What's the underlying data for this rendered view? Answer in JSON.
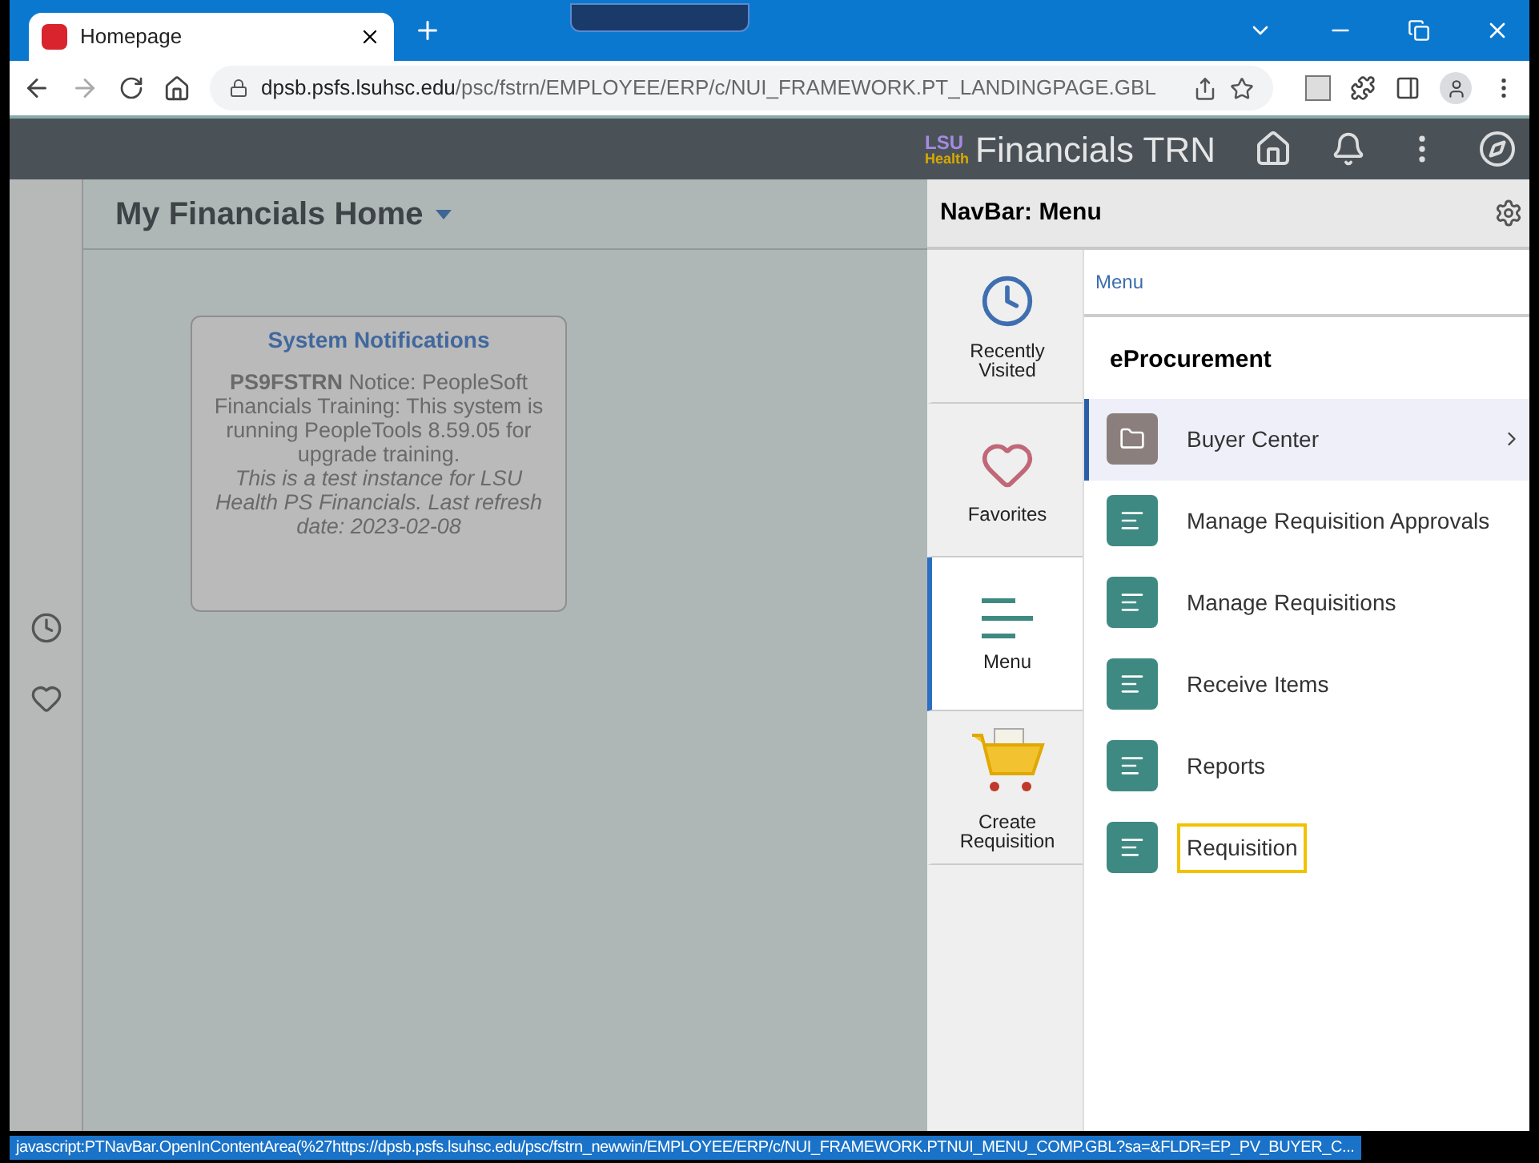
{
  "browser": {
    "tab_title": "Homepage",
    "url_host": "dpsb.psfs.lsuhsc.edu",
    "url_path": "/psc/fstrn/EMPLOYEE/ERP/c/NUI_FRAMEWORK.PT_LANDINGPAGE.GBL",
    "status_url": "javascript:PTNavBar.OpenInContentArea(%27https://dpsb.psfs.lsuhsc.edu/psc/fstrn_newwin/EMPLOYEE/ERP/c/NUI_FRAMEWORK.PTNUI_MENU_COMP.GBL?sa=&FLDR=EP_PV_BUYER_C..."
  },
  "header": {
    "logo_top": "LSU",
    "logo_bottom": "Health",
    "title": "Financials TRN"
  },
  "page": {
    "title": "My Financials Home"
  },
  "notification": {
    "title": "System Notifications",
    "body": "**PS9FSTRN** Notice: PeopleSoft Financials Training: This system is running PeopleTools 8.59.05 for upgrade training.",
    "note": "This is a test instance for LSU Health PS Financials. Last refresh date: 2023-02-08"
  },
  "navbar": {
    "title": "NavBar: Menu",
    "tabs": [
      {
        "kind": "clock",
        "label": "Recently Visited",
        "selected": false
      },
      {
        "kind": "heart",
        "label": "Favorites",
        "selected": false
      },
      {
        "kind": "menu",
        "label": "Menu",
        "selected": true
      },
      {
        "kind": "cart",
        "label": "Create Requisition",
        "selected": false
      }
    ],
    "breadcrumb": "Menu",
    "section": "eProcurement",
    "items": [
      {
        "kind": "folder",
        "label": "Buyer Center",
        "selected": true,
        "highlighted": false
      },
      {
        "kind": "content",
        "label": "Manage Requisition Approvals",
        "selected": false,
        "highlighted": false
      },
      {
        "kind": "content",
        "label": "Manage Requisitions",
        "selected": false,
        "highlighted": false
      },
      {
        "kind": "content",
        "label": "Receive Items",
        "selected": false,
        "highlighted": false
      },
      {
        "kind": "content",
        "label": "Reports",
        "selected": false,
        "highlighted": false
      },
      {
        "kind": "content",
        "label": "Requisition",
        "selected": false,
        "highlighted": true
      }
    ]
  }
}
